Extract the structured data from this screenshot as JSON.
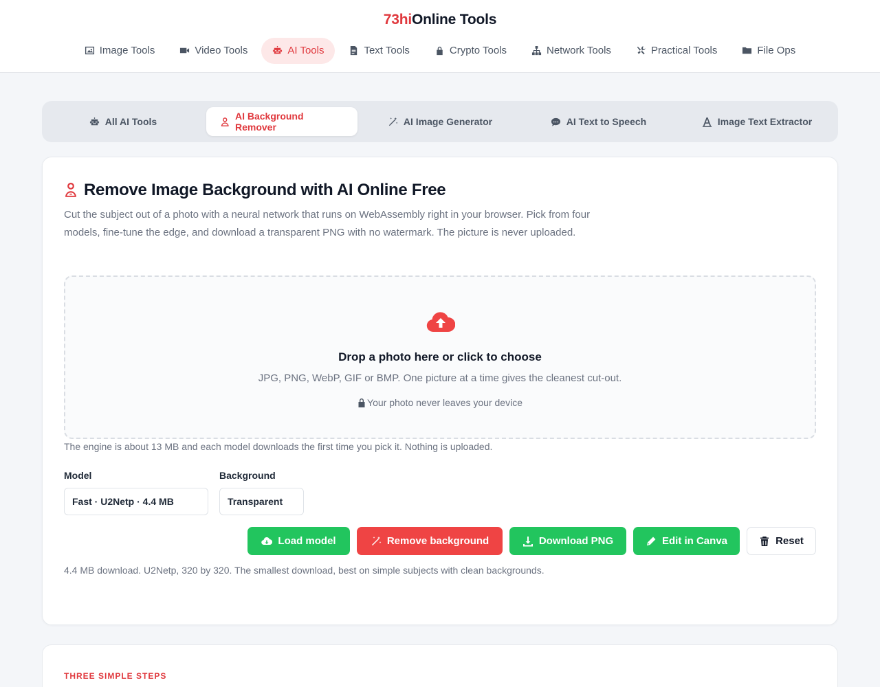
{
  "brand": {
    "accent": "73hi",
    "rest": "Online Tools"
  },
  "nav": [
    {
      "label": "Image Tools",
      "icon": "image-icon"
    },
    {
      "label": "Video Tools",
      "icon": "video-icon"
    },
    {
      "label": "AI Tools",
      "icon": "robot-icon",
      "active": true
    },
    {
      "label": "Text Tools",
      "icon": "file-text-icon"
    },
    {
      "label": "Crypto Tools",
      "icon": "lock-icon"
    },
    {
      "label": "Network Tools",
      "icon": "network-icon"
    },
    {
      "label": "Practical Tools",
      "icon": "tools-icon"
    },
    {
      "label": "File Ops",
      "icon": "folder-icon"
    }
  ],
  "subnav": [
    {
      "label": "All AI Tools",
      "icon": "robot-icon"
    },
    {
      "label": "AI Background Remover",
      "icon": "user-cutout-icon",
      "active": true
    },
    {
      "label": "AI Image Generator",
      "icon": "magic-wand-icon"
    },
    {
      "label": "AI Text to Speech",
      "icon": "speech-bubble-icon"
    },
    {
      "label": "Image Text Extractor",
      "icon": "text-glyph-icon"
    }
  ],
  "tool": {
    "title": "Remove Image Background with AI Online Free",
    "description": "Cut the subject out of a photo with a neural network that runs on WebAssembly right in your browser. Pick from four models, fine-tune the edge, and download a transparent PNG with no watermark. The picture is never uploaded.",
    "dropzone": {
      "title": "Drop a photo here or click to choose",
      "subtitle": "JPG, PNG, WebP, GIF or BMP. One picture at a time gives the cleanest cut-out.",
      "privacy": "Your photo never leaves your device"
    },
    "engine_note": "The engine is about 13 MB and each model downloads the first time you pick it. Nothing is uploaded.",
    "model_label": "Model",
    "model_value": "Fast · U2Netp · 4.4 MB",
    "background_label": "Background",
    "background_value": "Transparent",
    "buttons": {
      "load": "Load model",
      "remove": "Remove background",
      "download": "Download PNG",
      "canva": "Edit in Canva",
      "reset": "Reset"
    },
    "model_info": "4.4 MB download. U2Netp, 320 by 320. The smallest download, best on simple subjects with clean backgrounds."
  },
  "steps_label": "THREE SIMPLE STEPS",
  "colors": {
    "accent": "#e0393e",
    "green": "#22c55e",
    "red": "#ef4444"
  }
}
